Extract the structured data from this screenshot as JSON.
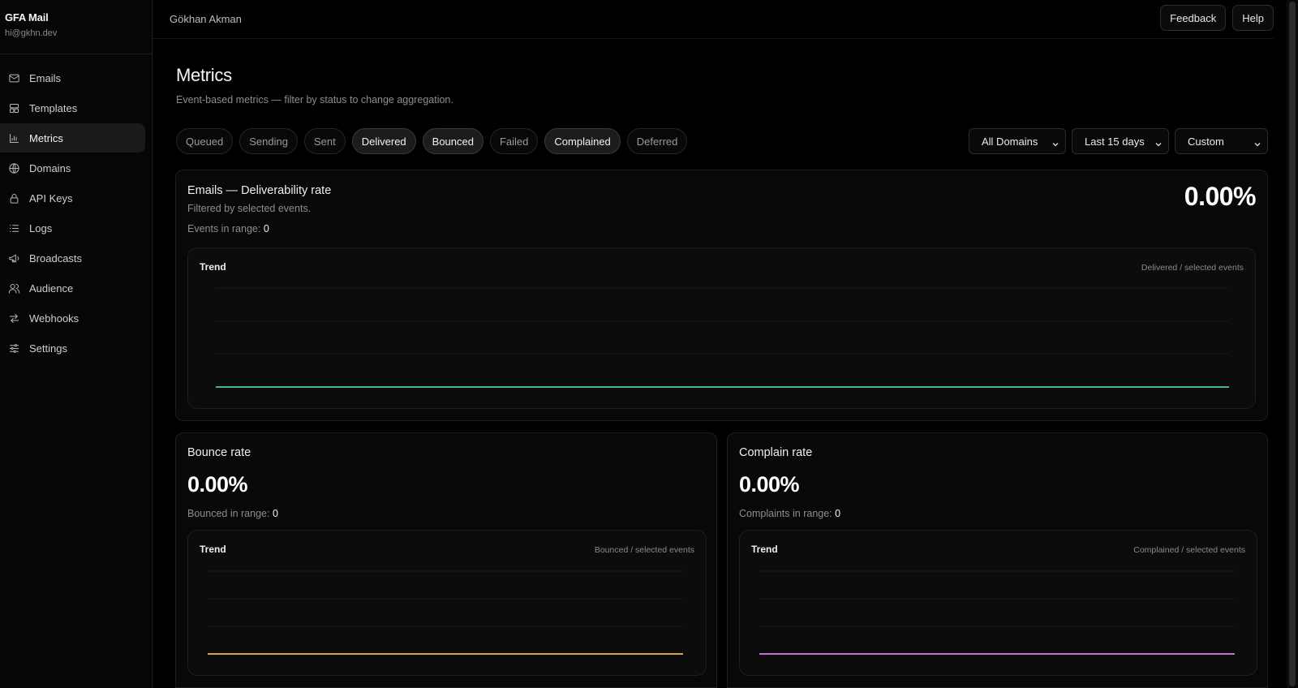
{
  "sidebar": {
    "brand_name": "GFA Mail",
    "brand_email": "hi@gkhn.dev",
    "items": [
      {
        "label": "Emails",
        "icon": "mail-icon",
        "active": false
      },
      {
        "label": "Templates",
        "icon": "layout-icon",
        "active": false
      },
      {
        "label": "Metrics",
        "icon": "bar-chart-icon",
        "active": true
      },
      {
        "label": "Domains",
        "icon": "globe-icon",
        "active": false
      },
      {
        "label": "API Keys",
        "icon": "lock-icon",
        "active": false
      },
      {
        "label": "Logs",
        "icon": "list-icon",
        "active": false
      },
      {
        "label": "Broadcasts",
        "icon": "megaphone-icon",
        "active": false
      },
      {
        "label": "Audience",
        "icon": "users-icon",
        "active": false
      },
      {
        "label": "Webhooks",
        "icon": "arrows-icon",
        "active": false
      },
      {
        "label": "Settings",
        "icon": "sliders-icon",
        "active": false
      }
    ]
  },
  "topbar": {
    "user_name": "Gökhan Akman",
    "feedback_label": "Feedback",
    "help_label": "Help"
  },
  "page": {
    "title": "Metrics",
    "subtitle": "Event-based metrics — filter by status to change aggregation."
  },
  "filters": {
    "chips": [
      {
        "label": "Queued",
        "selected": false
      },
      {
        "label": "Sending",
        "selected": false
      },
      {
        "label": "Sent",
        "selected": false
      },
      {
        "label": "Delivered",
        "selected": true
      },
      {
        "label": "Bounced",
        "selected": true
      },
      {
        "label": "Failed",
        "selected": false
      },
      {
        "label": "Complained",
        "selected": true
      },
      {
        "label": "Deferred",
        "selected": false
      }
    ],
    "domain_select": "All Domains",
    "range_select": "Last 15 days",
    "custom_select": "Custom"
  },
  "deliverability": {
    "title": "Emails — Deliverability rate",
    "description": "Filtered by selected events.",
    "events_label": "Events in range:",
    "events_value": "0",
    "rate": "0.00%",
    "trend_label": "Trend",
    "trend_note": "Delivered / selected events",
    "line_color": "#3fb68b"
  },
  "bounce": {
    "title": "Bounce rate",
    "rate": "0.00%",
    "count_label": "Bounced in range:",
    "count_value": "0",
    "trend_label": "Trend",
    "trend_note": "Bounced / selected events",
    "line_color": "#d9a43a"
  },
  "complain": {
    "title": "Complain rate",
    "rate": "0.00%",
    "count_label": "Complaints in range:",
    "count_value": "0",
    "trend_label": "Trend",
    "trend_note": "Complained / selected events",
    "line_color": "#c46fd6"
  }
}
